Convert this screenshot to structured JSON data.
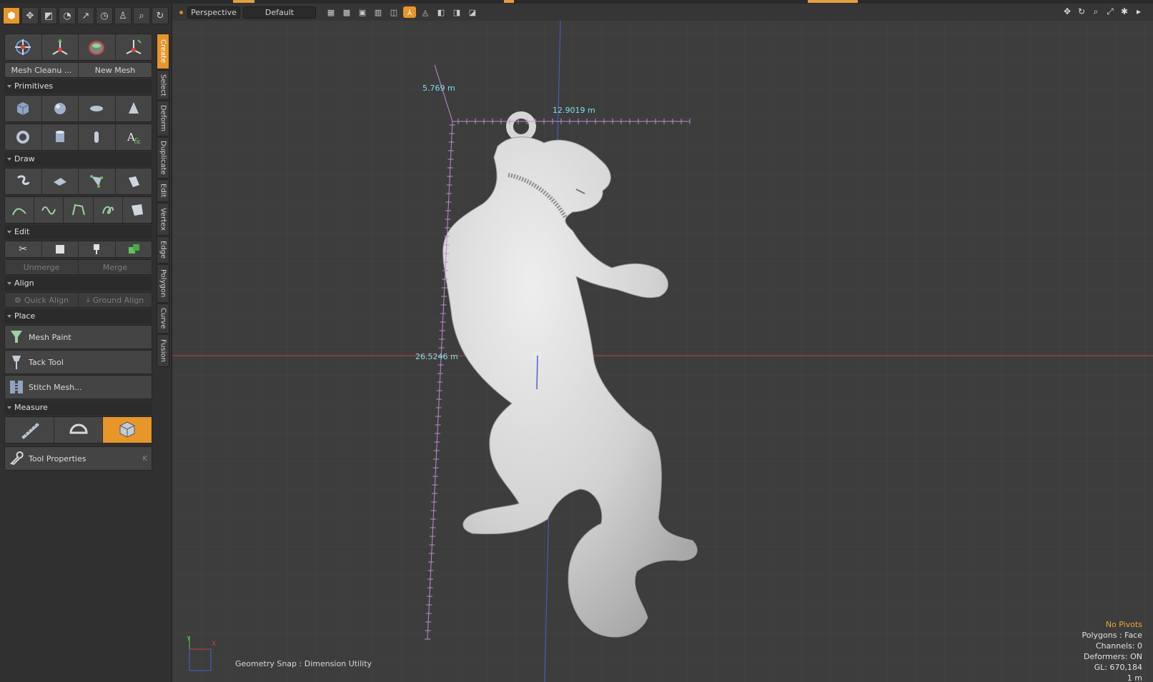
{
  "left_panel": {
    "mesh_buttons": [
      "Mesh Cleanu ...",
      "New Mesh"
    ],
    "sections": {
      "primitives": "Primitives",
      "draw": "Draw",
      "edit": "Edit",
      "align": "Align",
      "place": "Place",
      "measure": "Measure"
    },
    "edit_buttons": [
      "Unmerge",
      "Merge"
    ],
    "align_buttons": [
      "Quick Align",
      "Ground Align"
    ],
    "place_tools": [
      "Mesh Paint",
      "Tack Tool",
      "Stitch Mesh..."
    ],
    "tool_properties": {
      "label": "Tool Properties",
      "key": "K"
    },
    "vertical_tabs": [
      "Create",
      "Select",
      "Deform",
      "Duplicate",
      "Edit",
      "Vertex",
      "Edge",
      "Polygon",
      "Curve",
      "Fusion"
    ]
  },
  "viewport": {
    "view_mode": "Perspective",
    "shading": "Default",
    "measurements": {
      "height_top": "5.769 m",
      "width": "12.9019 m",
      "height": "26.5246 m"
    },
    "axis_labels": {
      "y": "Y",
      "x": "X"
    },
    "snap_info": "Geometry Snap : Dimension Utility",
    "status": [
      "No Pivots",
      "Polygons : Face",
      "Channels: 0",
      "Deformers: ON",
      "GL: 670,184",
      "1 m"
    ]
  },
  "colors": {
    "accent": "#e7962a",
    "measure": "#7de0ea",
    "x_axis": "#c84040",
    "y_axis": "#4a5fd8"
  }
}
